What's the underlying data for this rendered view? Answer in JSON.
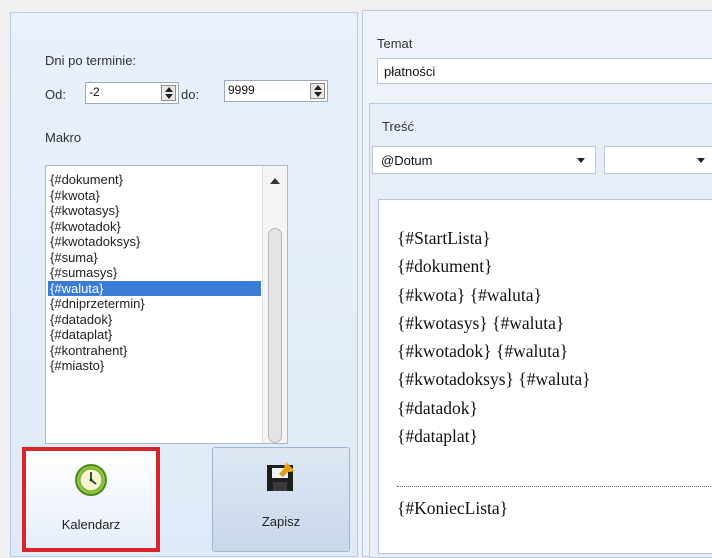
{
  "filter": {
    "days_overdue_label": "Dni po terminie:",
    "from_label": "Od:",
    "from_value": "-2",
    "to_label": "do:",
    "to_value": "9999"
  },
  "macro": {
    "label": "Makro",
    "items": [
      "{#dokument}",
      "{#kwota}",
      "{#kwotasys}",
      "{#kwotadok}",
      "{#kwotadoksys}",
      "{#suma}",
      "{#sumasys}",
      "{#waluta}",
      "{#dniprzetermin}",
      "{#datadok}",
      "{#dataplat}",
      "{#kontrahent}",
      "{#miasto}"
    ],
    "selected_index": 7
  },
  "buttons": {
    "calendar_label": "Kalendarz",
    "save_label": "Zapisz"
  },
  "subject": {
    "label": "Temat",
    "value": "płatności"
  },
  "body": {
    "label": "Treść",
    "field_combo_value": "@Dotum",
    "second_combo_value": "",
    "lines": [
      "{#StartLista}",
      "{#dokument}",
      "{#kwota} {#waluta}",
      "{#kwotasys} {#waluta}",
      "{#kwotadok} {#waluta}",
      "{#kwotadoksys} {#waluta}",
      "{#datadok}",
      "{#dataplat}"
    ],
    "end_line": "{#KoniecLista}"
  },
  "colors": {
    "highlight_border": "#d9242b",
    "selection": "#3a7bd5"
  },
  "icons": {
    "calendar": "clock-icon",
    "save": "save-icon"
  }
}
